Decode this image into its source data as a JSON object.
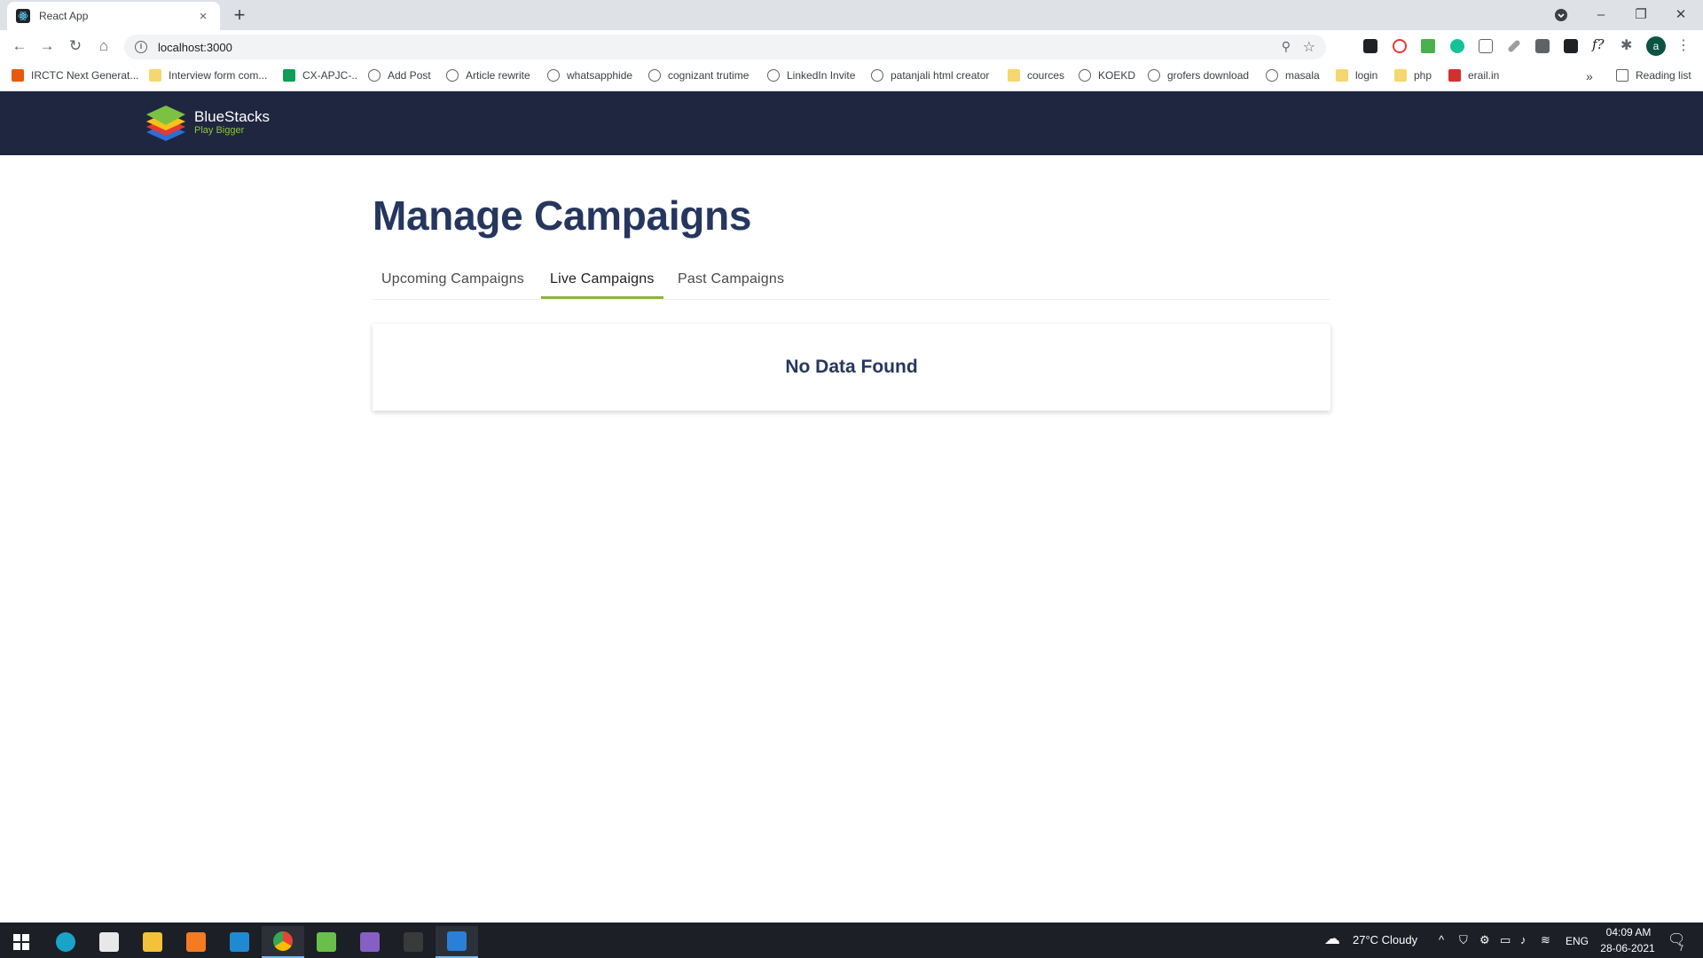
{
  "browser": {
    "tab_title": "React App",
    "tab_close": "×",
    "new_tab": "+",
    "window_controls": [
      "–",
      "❐",
      "✕"
    ],
    "url": "localhost:3000",
    "bookmarks": [
      {
        "label": "IRCTC Next Generat...",
        "icon": "irctc-icon"
      },
      {
        "label": "Interview form com...",
        "icon": "folder-icon"
      },
      {
        "label": "CX-APJC-..",
        "icon": "sheets-icon"
      },
      {
        "label": "Add Post",
        "icon": "globe-icon"
      },
      {
        "label": "Article rewrite",
        "icon": "globe-icon"
      },
      {
        "label": "whatsapphide",
        "icon": "globe-icon"
      },
      {
        "label": "cognizant trutime",
        "icon": "globe-icon"
      },
      {
        "label": "LinkedIn Invite",
        "icon": "globe-icon"
      },
      {
        "label": "patanjali html creator",
        "icon": "globe-icon"
      },
      {
        "label": "cources",
        "icon": "folder-icon"
      },
      {
        "label": "KOEKD",
        "icon": "globe-icon"
      },
      {
        "label": "grofers download",
        "icon": "globe-icon"
      },
      {
        "label": "masala",
        "icon": "globe-icon"
      },
      {
        "label": "login",
        "icon": "folder-icon"
      },
      {
        "label": "php",
        "icon": "folder-icon"
      },
      {
        "label": "erail.in",
        "icon": "train-icon"
      }
    ],
    "bookmarks_overflow": "»",
    "reading_list": "Reading list",
    "profile_initial": "a"
  },
  "app": {
    "brand": "BlueStacks",
    "tagline": "Play Bigger",
    "page_title": "Manage Campaigns",
    "tabs": [
      {
        "label": "Upcoming Campaigns",
        "active": false
      },
      {
        "label": "Live Campaigns",
        "active": true
      },
      {
        "label": "Past Campaigns",
        "active": false
      }
    ],
    "empty_message": "No Data Found",
    "accent_color": "#8db33a",
    "header_color": "#1f2640",
    "title_color": "#26365e"
  },
  "taskbar": {
    "weather": "27°C  Cloudy",
    "language": "ENG",
    "time": "04:09 AM",
    "date": "28-06-2021",
    "notification_count": "7"
  }
}
